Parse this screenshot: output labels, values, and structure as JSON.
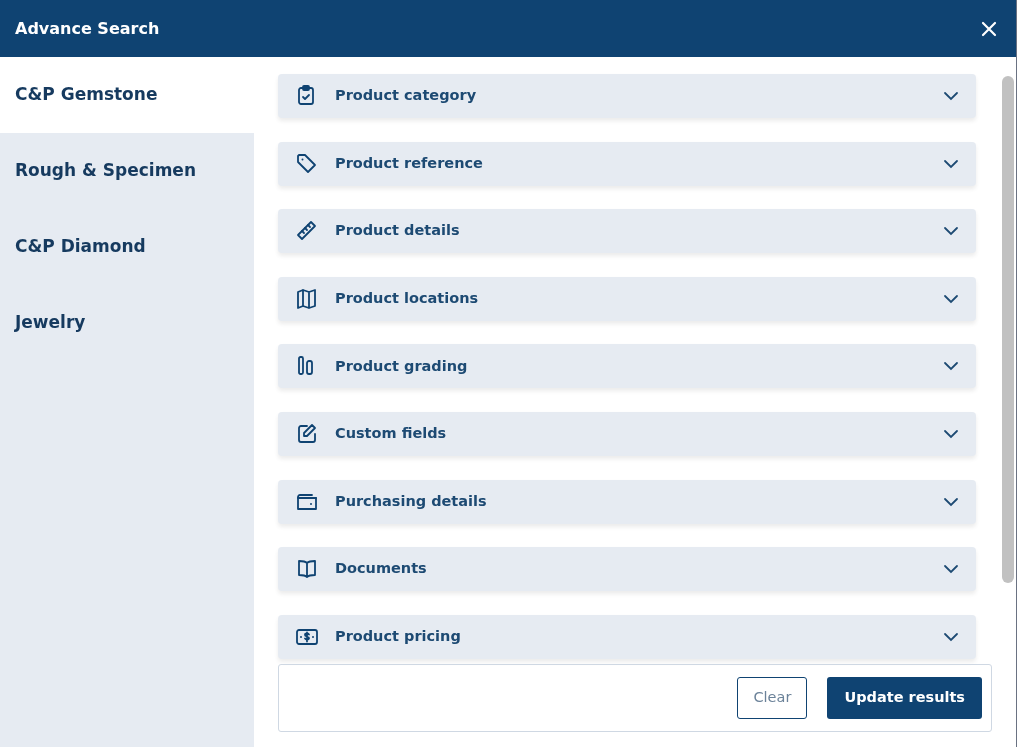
{
  "window": {
    "title": "Advance Search"
  },
  "sidebar": {
    "items": [
      {
        "label": "C&P Gemstone",
        "selected": true
      },
      {
        "label": "Rough & Specimen",
        "selected": false
      },
      {
        "label": "C&P Diamond",
        "selected": false
      },
      {
        "label": "Jewelry",
        "selected": false
      }
    ]
  },
  "sections": [
    {
      "kind": "clipboard",
      "label": "Product category"
    },
    {
      "kind": "tag",
      "label": "Product reference"
    },
    {
      "kind": "ruler",
      "label": "Product details"
    },
    {
      "kind": "map",
      "label": "Product locations"
    },
    {
      "kind": "bars",
      "label": "Product grading"
    },
    {
      "kind": "edit",
      "label": "Custom fields"
    },
    {
      "kind": "wallet",
      "label": "Purchasing details"
    },
    {
      "kind": "book",
      "label": "Documents"
    },
    {
      "kind": "money",
      "label": "Product pricing"
    }
  ],
  "footer": {
    "buttons": [
      {
        "kind": "secondary",
        "label": "Clear"
      },
      {
        "kind": "primary",
        "label": "Update results"
      }
    ]
  }
}
